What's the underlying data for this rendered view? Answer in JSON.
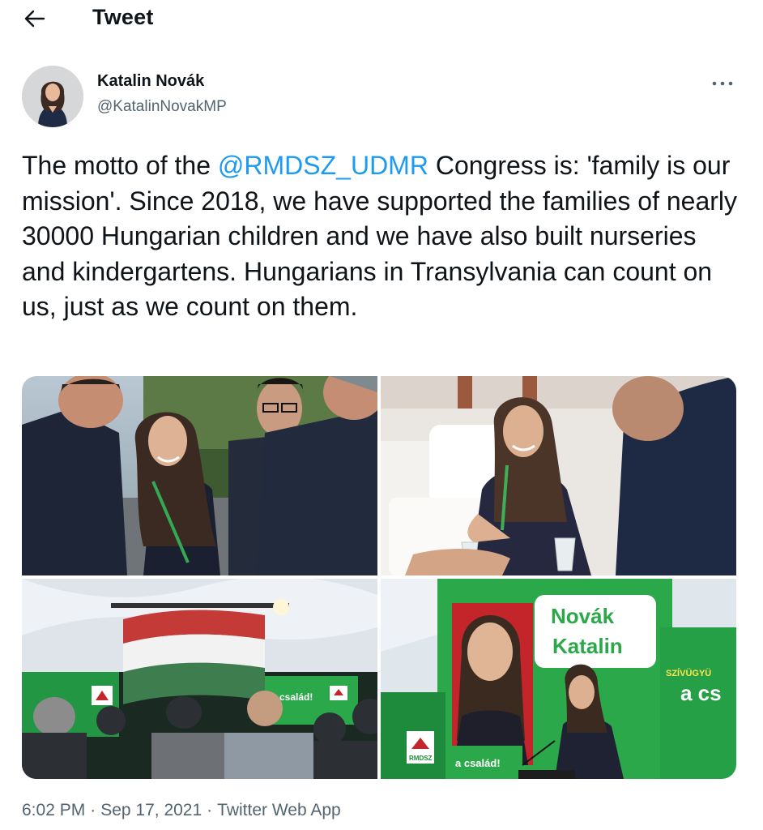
{
  "header": {
    "back_icon": "arrow-left-icon",
    "title": "Tweet"
  },
  "author": {
    "name": "Katalin Novák",
    "handle": "@KatalinNovakMP",
    "more_icon": "more-horizontal-icon"
  },
  "tweet": {
    "text_before_mention": "The motto of the ",
    "mention": "@RMDSZ_UDMR",
    "text_after_mention": " Congress is: 'family is our mission'. Since 2018, we have supported the families of nearly 30000 Hungarian children and we have also built nurseries and kindergartens. Hungarians in Transylvania can count on us, just as we count on them."
  },
  "photos": {
    "photo4_sign_line1": "Novák",
    "photo4_sign_line2": "Katalin",
    "photo4_banner_small": "SZÍVÜGYÜ",
    "photo4_banner_big": "a cs",
    "photo4_podium": "a család!",
    "photo3_banner": "a család!",
    "logo_text": "RMDSZ"
  },
  "meta": {
    "time": "6:02 PM",
    "date": "Sep 17, 2021",
    "separator": "·",
    "source": "Twitter Web App"
  },
  "colors": {
    "link_blue": "#1d9bf0",
    "secondary_text": "#536471",
    "rmdsz_green": "#2aa84a"
  }
}
